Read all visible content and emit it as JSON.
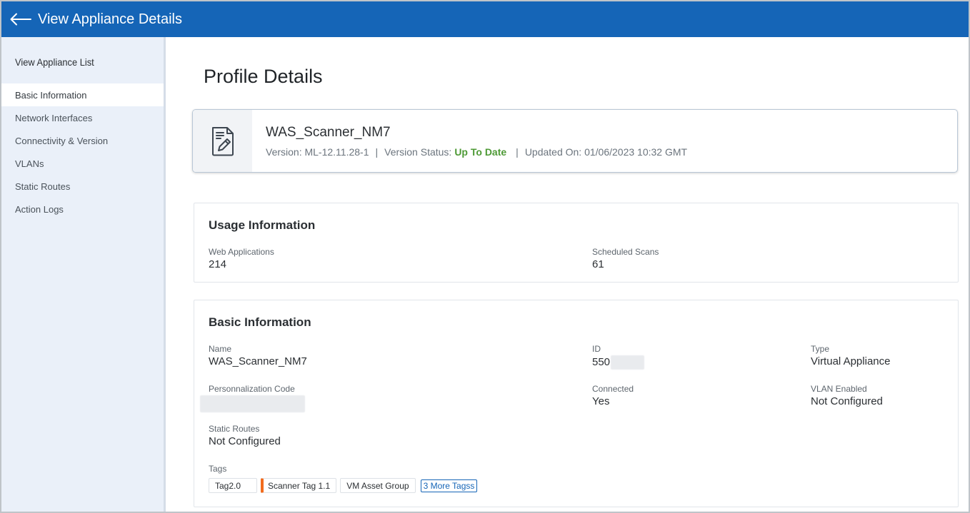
{
  "header": {
    "title": "View Appliance Details"
  },
  "sidebar": {
    "heading": "View Appliance List",
    "items": [
      {
        "label": "Basic Information"
      },
      {
        "label": "Network Interfaces"
      },
      {
        "label": "Connectivity & Version"
      },
      {
        "label": "VLANs"
      },
      {
        "label": "Static Routes"
      },
      {
        "label": "Action Logs"
      }
    ],
    "active_item": "Basic Information"
  },
  "page": {
    "title": "Profile Details"
  },
  "profile": {
    "name": "WAS_Scanner_NM7",
    "version": "Version: ML-12.11.28-1",
    "status_label": "Version Status:",
    "status_value": "Up To Date",
    "updated": "Updated On: 01/06/2023 10:32 GMT",
    "separator": "|"
  },
  "usage": {
    "title": "Usage Information",
    "web_apps_label": "Web Applications",
    "web_apps_value": "214",
    "scheduled_label": "Scheduled Scans",
    "scheduled_value": "61"
  },
  "basic": {
    "title": "Basic Information",
    "name_label": "Name",
    "name_value": "WAS_Scanner_NM7",
    "id_label": "ID",
    "id_value_prefix": "550",
    "type_label": "Type",
    "type_value": "Virtual Appliance",
    "perso_label": "Personnalization Code",
    "connected_label": "Connected",
    "connected_value": "Yes",
    "vlan_label": "VLAN Enabled",
    "vlan_value": "Not Configured",
    "routes_label": "Static Routes",
    "routes_value": "Not Configured",
    "tags_label": "Tags",
    "tags": [
      {
        "label": "Tag2.0"
      },
      {
        "label": "Scanner Tag 1.1"
      },
      {
        "label": "VM Asset Group"
      }
    ],
    "more_tags": "3 More Tagss"
  },
  "colors": {
    "header_bg": "#1565b7",
    "sidebar_bg": "#eaf0f9",
    "status_green": "#4e9a36",
    "tag_accent": "#f26b1d"
  },
  "icons": {
    "back": "arrow-left-icon",
    "profile": "document-edit-icon"
  }
}
